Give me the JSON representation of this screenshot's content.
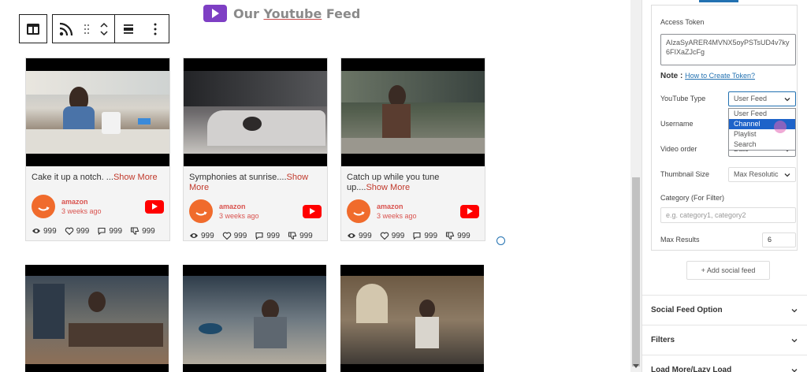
{
  "title": {
    "prefix": "Our ",
    "underlined": "Youtube",
    "suffix": " Feed"
  },
  "toolbar": {
    "items": [
      "block-type-button",
      "rss-button",
      "drag-handle",
      "move-up-down",
      "align-button",
      "more-options"
    ]
  },
  "cards": [
    {
      "caption": "Cake it up a notch. ...",
      "more": "Show More",
      "author": "amazon",
      "time": "3 weeks ago",
      "views": "999",
      "likes": "999",
      "comments": "999",
      "dislikes": "999"
    },
    {
      "caption": "Symphonies at sunrise....",
      "more": "Show More",
      "author": "amazon",
      "time": "3 weeks ago",
      "views": "999",
      "likes": "999",
      "comments": "999",
      "dislikes": "999"
    },
    {
      "caption": "Catch up while you tune up....",
      "more": "Show More",
      "author": "amazon",
      "time": "3 weeks ago",
      "views": "999",
      "likes": "999",
      "comments": "999",
      "dislikes": "999"
    }
  ],
  "panel": {
    "access_token_label": "Access Token",
    "access_token_value": "AIzaSyARER4MVNX5oyPSTsUD4v7ky6FIXaZJcFg",
    "note_label": "Note :",
    "note_link": "How to Create Token?",
    "youtube_type_label": "YouTube Type",
    "youtube_type_value": "User Feed",
    "youtube_type_options": [
      "User Feed",
      "Channel",
      "Playlist",
      "Search"
    ],
    "username_label": "Username",
    "video_order_label": "Video order",
    "video_order_value": "Date",
    "thumbnail_size_label": "Thumbnail Size",
    "thumbnail_size_value": "Max Resolutic",
    "category_label": "Category (For Filter)",
    "category_placeholder": "e.g. category1, category2",
    "max_results_label": "Max Results",
    "max_results_value": "6",
    "add_feed_label": "+ Add social feed",
    "sections": [
      "Social Feed Option",
      "Filters",
      "Load More/Lazy Load"
    ]
  },
  "colors": {
    "accent": "#2271b1",
    "brand_purple": "#7e3fc4",
    "youtube_red": "#ff0000",
    "amazon_orange": "#f06b2c",
    "show_more": "#c0392b"
  }
}
